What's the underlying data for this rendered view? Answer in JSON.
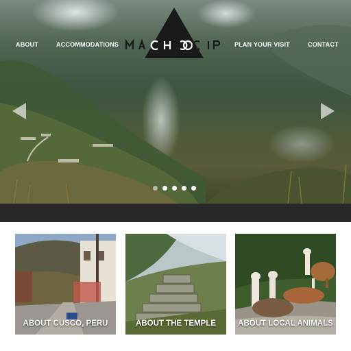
{
  "nav": {
    "about": "ABOUT",
    "accommodations": "ACCOMMODATIONS",
    "plan_visit": "PLAN YOUR VISIT",
    "contact": "CONTACT"
  },
  "logo": {
    "text": "MACHO PICCHU",
    "triangle_color": "#1a1a1a"
  },
  "slider": {
    "slide_count": 5,
    "active_index": 1,
    "prev_icon": "chevron-left-icon",
    "next_icon": "chevron-right-icon"
  },
  "cards": [
    {
      "label": "ABOUT CUSCO, PERU"
    },
    {
      "label": "ABOUT THE TEMPLE"
    },
    {
      "label": "ABOUT LOCAL ANIMALS"
    }
  ],
  "colors": {
    "band": "#282828",
    "nav_text": "#ffffff"
  }
}
